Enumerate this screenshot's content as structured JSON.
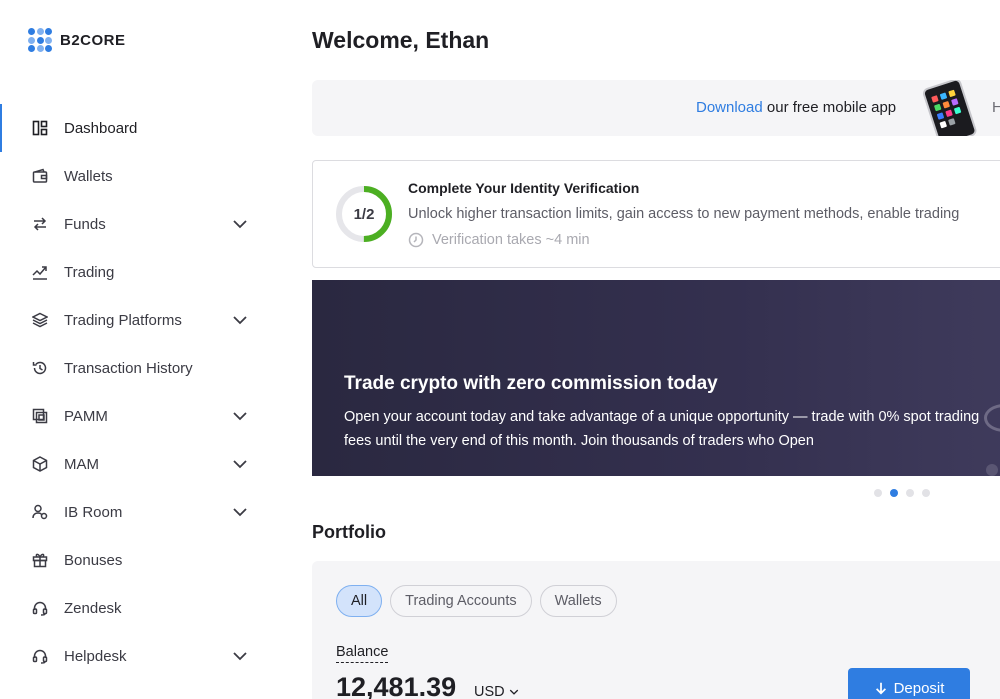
{
  "app": {
    "logo_text": "B2CORE"
  },
  "sidebar": {
    "items": [
      {
        "label": "Dashboard",
        "icon": "dashboard-icon",
        "active": true,
        "expandable": false
      },
      {
        "label": "Wallets",
        "icon": "wallet-icon",
        "active": false,
        "expandable": false
      },
      {
        "label": "Funds",
        "icon": "transfer-arrows-icon",
        "active": false,
        "expandable": true
      },
      {
        "label": "Trading",
        "icon": "trending-chart-icon",
        "active": false,
        "expandable": false
      },
      {
        "label": "Trading Platforms",
        "icon": "layers-icon",
        "active": false,
        "expandable": true
      },
      {
        "label": "Transaction History",
        "icon": "history-icon",
        "active": false,
        "expandable": false
      },
      {
        "label": "PAMM",
        "icon": "copy-frame-icon",
        "active": false,
        "expandable": true
      },
      {
        "label": "MAM",
        "icon": "cube-icon",
        "active": false,
        "expandable": true
      },
      {
        "label": "IB Room",
        "icon": "user-network-icon",
        "active": false,
        "expandable": true
      },
      {
        "label": "Bonuses",
        "icon": "gift-icon",
        "active": false,
        "expandable": false
      },
      {
        "label": "Zendesk",
        "icon": "headset-icon",
        "active": false,
        "expandable": false
      },
      {
        "label": "Helpdesk",
        "icon": "headset-icon",
        "active": false,
        "expandable": true
      }
    ]
  },
  "main": {
    "welcome": "Welcome, Ethan",
    "app_banner": {
      "link": "Download",
      "text": " our free mobile app",
      "tail": "H"
    },
    "verification": {
      "progress_label": "1/2",
      "progress_fraction": 0.5,
      "title": "Complete Your Identity Verification",
      "description": "Unlock higher transaction limits, gain access to new payment methods, enable trading",
      "time": "Verification takes ~4 min"
    },
    "promo": {
      "title": "Trade crypto with zero commission today",
      "text": "Open your account today and take advantage of a unique opportunity — trade with 0% spot trading fees until the very end of this month. Join thousands of traders who Open"
    },
    "carousel": {
      "count": 4,
      "active_index": 1
    },
    "portfolio": {
      "title": "Portfolio",
      "tabs": [
        {
          "label": "All",
          "active": true
        },
        {
          "label": "Trading Accounts",
          "active": false
        },
        {
          "label": "Wallets",
          "active": false
        }
      ],
      "balance_label": "Balance",
      "balance_value": "12,481.39",
      "currency": "USD",
      "deposit_label": "Deposit"
    }
  },
  "colors": {
    "accent": "#2f7de1",
    "success": "#4caf22",
    "promo_bg": "#2a2840"
  }
}
